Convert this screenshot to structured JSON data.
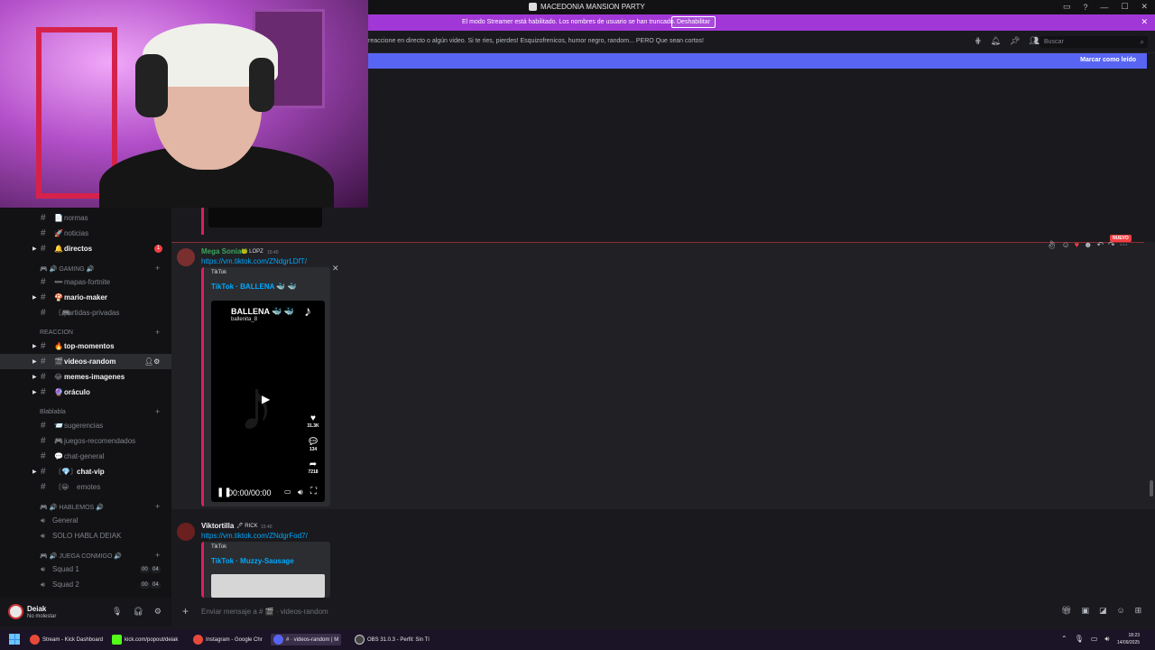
{
  "window": {
    "title": "MACEDONIA MANSION PARTY"
  },
  "banner": {
    "text": "El modo Streamer está habilitado. Los nombres de usuario se han truncado.",
    "button": "Deshabilitar",
    "close": "✕"
  },
  "topic": {
    "text": "reaccione en directo o algún video. Si te ries, pierdes! Esquizofrenicos, humor negro, random... PERO Que sean cortos!",
    "search_placeholder": "Buscar"
  },
  "mark_read": "Marcar como leído",
  "sidebar": {
    "channels": [
      {
        "name": "normas",
        "emoji": "📄",
        "style": "dim"
      },
      {
        "name": "noticias",
        "emoji": "🚀",
        "style": "dim"
      },
      {
        "name": "directos",
        "emoji": "🔔",
        "style": "bright",
        "badge": "1"
      }
    ],
    "cat_gaming": "🎮 🔊 GAMING 🔊",
    "gaming": [
      {
        "name": "mapas-fortnite",
        "emoji": "➖",
        "style": "dim"
      },
      {
        "name": "mario-maker",
        "emoji": "🍄",
        "style": "bright"
      },
      {
        "name": "partidas-privadas",
        "emoji": "〔🎮",
        "style": "dim"
      }
    ],
    "cat_reaccion": "REACCION",
    "reaccion": [
      {
        "name": "top-momentos",
        "emoji": "🔥",
        "style": "bright"
      },
      {
        "name": "videos-random",
        "emoji": "🎬",
        "style": "active"
      },
      {
        "name": "memes-imagenes",
        "emoji": "😂",
        "style": "bright"
      },
      {
        "name": "oráculo",
        "emoji": "🔮",
        "style": "bright"
      }
    ],
    "cat_blabla": "Blablabla",
    "blabla": [
      {
        "name": "sugerencias",
        "emoji": "📨",
        "style": "dim"
      },
      {
        "name": "juegos-recomendados",
        "emoji": "🎮",
        "style": "dim"
      },
      {
        "name": "chat-general",
        "emoji": "💬",
        "style": "dim"
      },
      {
        "name": "chat-vip",
        "emoji": "〔💎〕",
        "style": "bright"
      },
      {
        "name": "emotes",
        "emoji": "〔😀",
        "style": "dim"
      }
    ],
    "cat_hablemos": "🎮 🔊 HABLEMOS 🔊",
    "hablemos": [
      {
        "name": "General"
      },
      {
        "name": "SOLO HABLA DEIAK"
      }
    ],
    "cat_juega": "🎮 🔊 JUEGA CONMIGO 🔊",
    "juega": [
      {
        "name": "Squad 1",
        "c1": "00",
        "c2": "04"
      },
      {
        "name": "Squad 2",
        "c1": "00",
        "c2": "04"
      }
    ]
  },
  "user": {
    "name": "Deiak",
    "status": "No molestar"
  },
  "messages": [
    {
      "author": "Mega Sonia",
      "author_color": "#3ba55c",
      "tag": "🐸 LOPZ",
      "time": "15:40",
      "link": "https://vm.tiktok.com/ZNdgrLDfT/",
      "provider": "TikTok",
      "embed_title": "TikTok · BALLENA 🐳 🐳",
      "video_title": "BALLENA 🐳 🐳",
      "video_user": "ballenita_8",
      "likes": "31.3K",
      "comments": "134",
      "shares": "7218",
      "time_display": "00:00/00:00"
    },
    {
      "author": "Viktortilla",
      "author_color": "#f2f3f5",
      "tag": "🖊 RICK",
      "time": "15:40",
      "link": "https://vm.tiktok.com/ZNdgrFod7/",
      "provider": "TikTok",
      "embed_title": "TikTok · Muzzy-Sausage"
    }
  ],
  "nuevo": "NUEVO",
  "composer": {
    "placeholder": "Enviar mensaje a # 🎬 · videos-random"
  },
  "taskbar": {
    "items": [
      "Stream - Kick Dashboard",
      "kick.com/popout/deiak",
      "Instagram - Google Chr",
      "# · videos-random | M",
      "OBS 31.0.3 - Perfil: Sin Tí"
    ],
    "time": "18:23",
    "date": "14/09/2025"
  },
  "colors": {
    "accent": "#5865f2",
    "banner": "#a137d6",
    "link": "#00a8fc",
    "embed_bar": "#e01e5a"
  }
}
